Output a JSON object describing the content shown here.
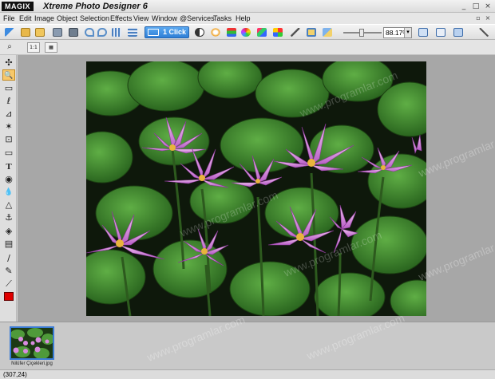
{
  "titlebar": {
    "brand": "MAGIX",
    "title": "Xtreme Photo Designer 6",
    "minimize": "_",
    "maximize": "□",
    "close": "×"
  },
  "menu": {
    "items": [
      "File",
      "Edit",
      "Image",
      "Object",
      "Selection",
      "Effects",
      "View",
      "Window",
      "@Services",
      "Tasks",
      "Help"
    ],
    "mdi_restore": "▫",
    "mdi_close": "×"
  },
  "toolbar": {
    "one_click_label": "1 Click",
    "zoom_value": "88.17%",
    "zoom_dropdown": "▾"
  },
  "tools": {
    "move": "✣",
    "zoom": "🔍",
    "rect_select": "▭",
    "lasso": "ℓ",
    "transform": "⊿",
    "magic_wand": "✶",
    "crop": "⊡",
    "eraser": "▭",
    "text": "T",
    "eye": "◉",
    "drop": "💧",
    "cone": "△",
    "stamp": "⚓",
    "fill": "◈",
    "gradient": "▤",
    "brush": "∕",
    "pencil": "✎",
    "eyedropper": "⟋"
  },
  "filmstrip": {
    "thumb_caption": "Nilüfer Çiçekleri.jpg"
  },
  "status": {
    "coords": "(307,24)"
  },
  "watermark": "www.programlar.com",
  "colors": {
    "accent": "#2f7fd6",
    "foreground_color": "#e00000",
    "selected_tool": "#f7c86a"
  }
}
